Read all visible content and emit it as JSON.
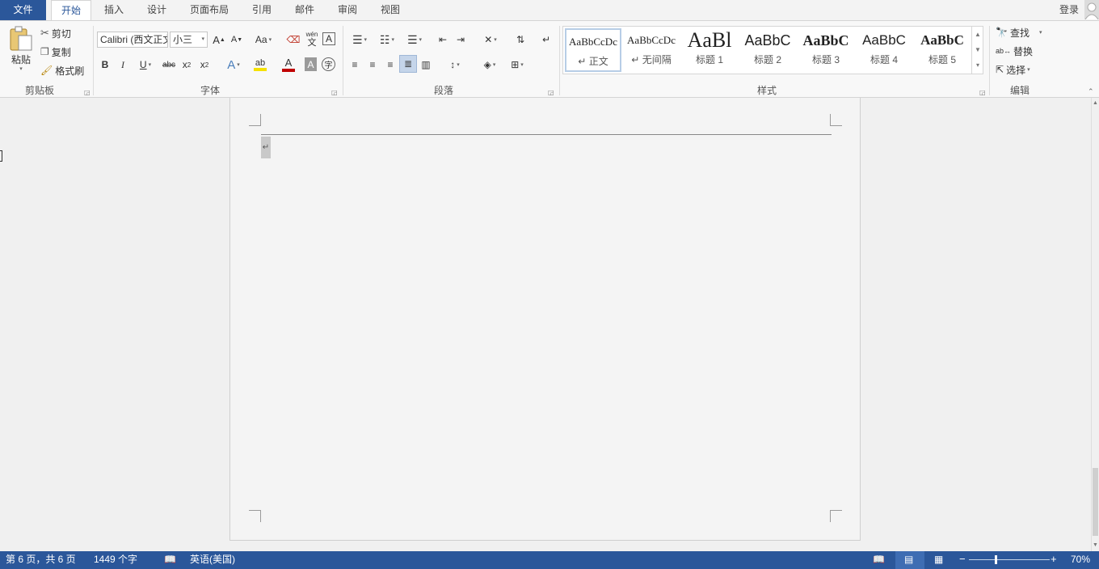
{
  "tabs": {
    "file": "文件",
    "home": "开始",
    "insert": "插入",
    "design": "设计",
    "layout": "页面布局",
    "references": "引用",
    "mailings": "邮件",
    "review": "审阅",
    "view": "视图"
  },
  "account": {
    "login": "登录"
  },
  "clipboard": {
    "paste": "粘贴",
    "cut": "剪切",
    "copy": "复制",
    "format_painter": "格式刷",
    "label": "剪贴板"
  },
  "font": {
    "name": "Calibri (西文正文",
    "size": "小三",
    "grow_icon": "A",
    "shrink_icon": "A",
    "change_case": "Aa",
    "pinyin_top": "wén",
    "pinyin_bottom": "文",
    "bold": "B",
    "italic": "I",
    "underline": "U",
    "strikethrough": "abc",
    "subscript": "x",
    "subscript_mark": "2",
    "superscript": "x",
    "superscript_mark": "2",
    "font_color": "A",
    "shading": "A",
    "enclose": "字",
    "label": "字体",
    "highlight_color": "#f5e100",
    "font_color_value": "#c00000"
  },
  "paragraph": {
    "label": "段落"
  },
  "styles": {
    "items": [
      {
        "sample": "AaBbCcDc",
        "name": "正文"
      },
      {
        "sample": "AaBbCcDc",
        "name": "无间隔"
      },
      {
        "sample": "AaBl",
        "name": "标题 1"
      },
      {
        "sample": "AaBbC",
        "name": "标题 2"
      },
      {
        "sample": "AaBbC",
        "name": "标题 3"
      },
      {
        "sample": "AaBbC",
        "name": "标题 4"
      },
      {
        "sample": "AaBbC",
        "name": "标题 5"
      }
    ],
    "label": "样式"
  },
  "editing": {
    "find": "查找",
    "replace": "替换",
    "select": "选择",
    "label": "编辑"
  },
  "document": {
    "paragraph_mark": "↵"
  },
  "status": {
    "page": "第 6 页，共 6 页",
    "words": "1449 个字",
    "language": "英语(美国)",
    "zoom": "70%",
    "zoom_level": 0.7
  },
  "colors": {
    "accent": "#2b579a",
    "status_bg": "#2b579a"
  }
}
